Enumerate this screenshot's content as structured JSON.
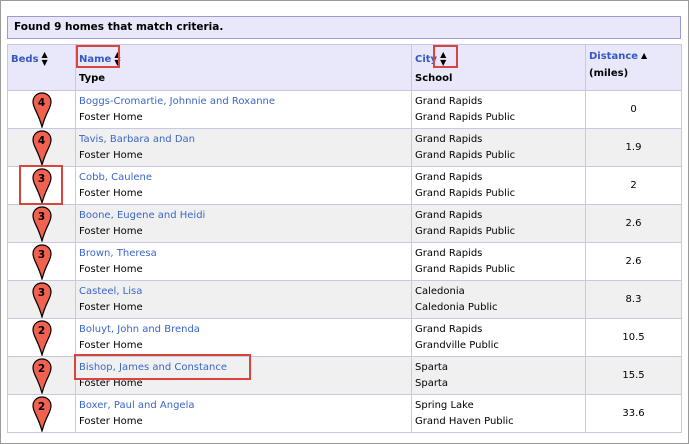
{
  "banner": "Found 9 homes that match criteria.",
  "headers": {
    "beds": "Beds",
    "name": "Name",
    "type": "Type",
    "city": "City",
    "school": "School",
    "distance": "Distance",
    "distance_unit": "(miles)",
    "sort_both_icon": "sort-both-icon",
    "sort_up_icon": "sort-ascending-icon"
  },
  "colors": {
    "pin": "#f0624f",
    "pin_outline": "#000000",
    "highlight": "#d9453c",
    "link": "#3458c4"
  },
  "rows": [
    {
      "beds": "4",
      "name": "Boggs-Cromartie, Johnnie and Roxanne",
      "type": "Foster Home",
      "city": "Grand Rapids",
      "school": "Grand Rapids Public",
      "distance": "0"
    },
    {
      "beds": "4",
      "name": "Tavis, Barbara and Dan",
      "type": "Foster Home",
      "city": "Grand Rapids",
      "school": "Grand Rapids Public",
      "distance": "1.9"
    },
    {
      "beds": "3",
      "name": "Cobb, Caulene",
      "type": "Foster Home",
      "city": "Grand Rapids",
      "school": "Grand Rapids Public",
      "distance": "2"
    },
    {
      "beds": "3",
      "name": "Boone, Eugene and Heidi",
      "type": "Foster Home",
      "city": "Grand Rapids",
      "school": "Grand Rapids Public",
      "distance": "2.6"
    },
    {
      "beds": "3",
      "name": "Brown, Theresa",
      "type": "Foster Home",
      "city": "Grand Rapids",
      "school": "Grand Rapids Public",
      "distance": "2.6"
    },
    {
      "beds": "3",
      "name": "Casteel, Lisa",
      "type": "Foster Home",
      "city": "Caledonia",
      "school": "Caledonia Public",
      "distance": "8.3"
    },
    {
      "beds": "2",
      "name": "Boluyt, John and Brenda",
      "type": "Foster Home",
      "city": "Grand Rapids",
      "school": "Grandville Public",
      "distance": "10.5"
    },
    {
      "beds": "2",
      "name": "Bishop, James and Constance",
      "type": "Foster Home",
      "city": "Sparta",
      "school": "Sparta",
      "distance": "15.5"
    },
    {
      "beds": "2",
      "name": "Boxer, Paul and Angela",
      "type": "Foster Home",
      "city": "Spring Lake",
      "school": "Grand Haven Public",
      "distance": "33.6"
    }
  ]
}
